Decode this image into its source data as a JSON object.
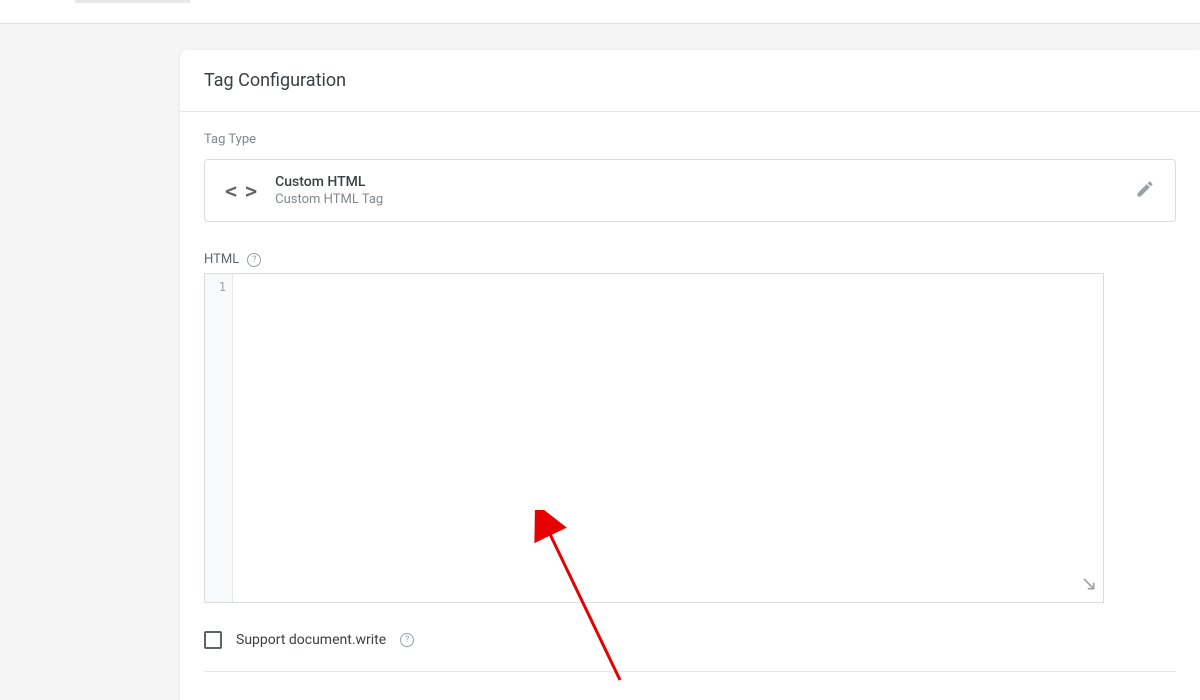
{
  "panel": {
    "title": "Tag Configuration"
  },
  "tag_type": {
    "section_label": "Tag Type",
    "title": "Custom HTML",
    "subtitle": "Custom HTML Tag"
  },
  "html_editor": {
    "label": "HTML",
    "line_number": "1"
  },
  "checkbox": {
    "label": "Support document.write"
  }
}
